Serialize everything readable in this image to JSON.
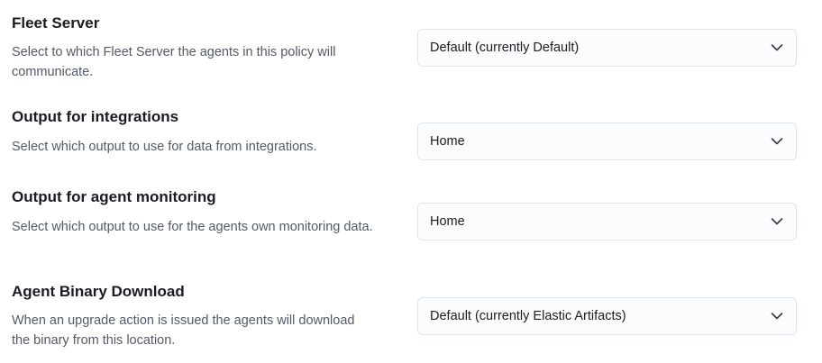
{
  "settings": [
    {
      "title": "Fleet Server",
      "description": "Select to which Fleet Server the agents in this policy will communicate.",
      "selected": "Default (currently Default)",
      "icon": "chevron-down-icon"
    },
    {
      "title": "Output for integrations",
      "description": "Select which output to use for data from integrations.",
      "selected": "Home",
      "icon": "chevron-down-icon"
    },
    {
      "title": "Output for agent monitoring",
      "description": "Select which output to use for the agents own monitoring data.",
      "selected": "Home",
      "icon": "chevron-down-icon"
    },
    {
      "title": "Agent Binary Download",
      "description": "When an upgrade action is issued the agents will download the binary from this location.",
      "selected": "Default (currently Elastic Artifacts)",
      "icon": "chevron-down-icon"
    }
  ],
  "colors": {
    "title": "#1a1c21",
    "description": "#535966",
    "select_border": "#dfe3ea",
    "select_background": "#fbfcfd"
  }
}
